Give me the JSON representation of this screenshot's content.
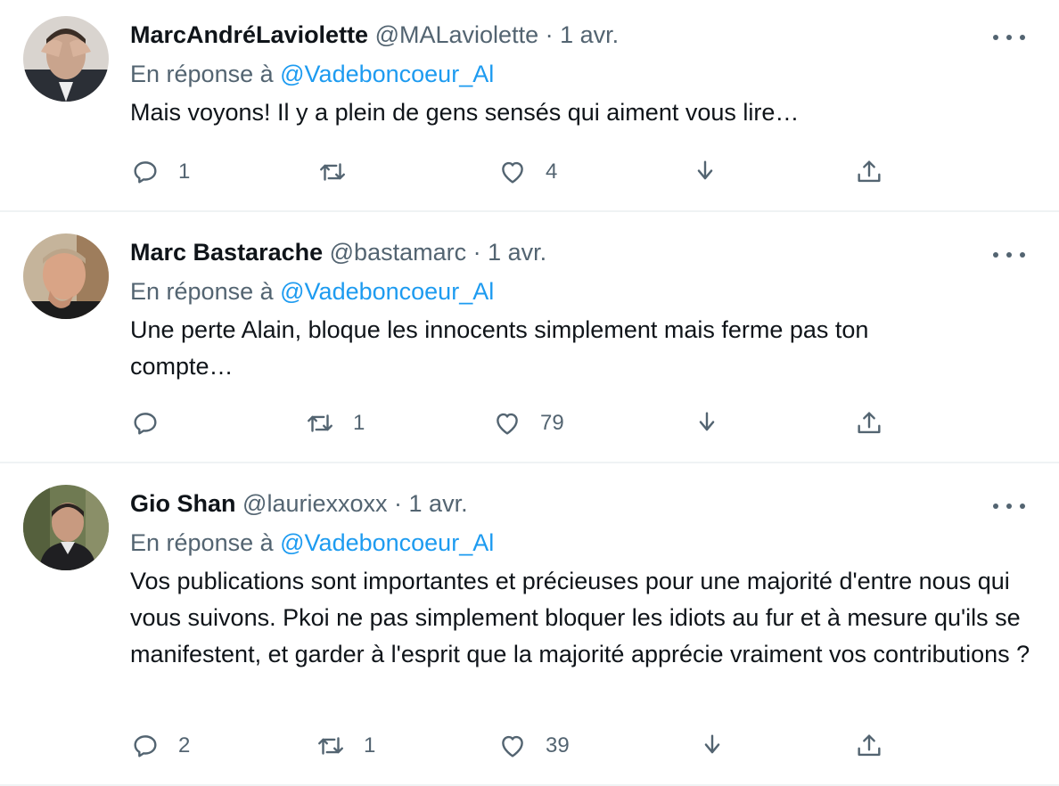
{
  "labels": {
    "reply_prefix": "En réponse à",
    "separator": "·"
  },
  "tweets": [
    {
      "display_name": "MarcAndréLaviolette",
      "handle": "@MALaviolette",
      "time": "1 avr.",
      "reply_to": "@Vadeboncoeur_Al",
      "text": "Mais voyons! Il y a plein de gens sensés qui aiment vous lire…",
      "replies": "1",
      "retweets": "",
      "likes": "4"
    },
    {
      "display_name": "Marc Bastarache",
      "handle": "@bastamarc",
      "time": "1 avr.",
      "reply_to": "@Vadeboncoeur_Al",
      "text": "Une perte Alain, bloque les innocents simplement mais ferme pas ton compte…",
      "replies": "",
      "retweets": "1",
      "likes": "79"
    },
    {
      "display_name": "Gio Shan",
      "handle": "@lauriexxoxx",
      "time": "1 avr.",
      "reply_to": "@Vadeboncoeur_Al",
      "text": "Vos publications sont importantes et précieuses pour une majorité d'entre nous qui vous suivons. Pkoi ne pas simplement bloquer les idiots au fur et à mesure qu'ils se manifestent, et garder à l'esprit que la majorité apprécie vraiment vos contributions ?",
      "replies": "2",
      "retweets": "1",
      "likes": "39"
    }
  ],
  "colors": {
    "text": "#0f1419",
    "secondary": "#536471",
    "link": "#1d9bf0",
    "divider": "#eff3f4"
  },
  "icons": [
    "reply-icon",
    "retweet-icon",
    "like-icon",
    "download-icon",
    "share-icon",
    "more-icon"
  ]
}
